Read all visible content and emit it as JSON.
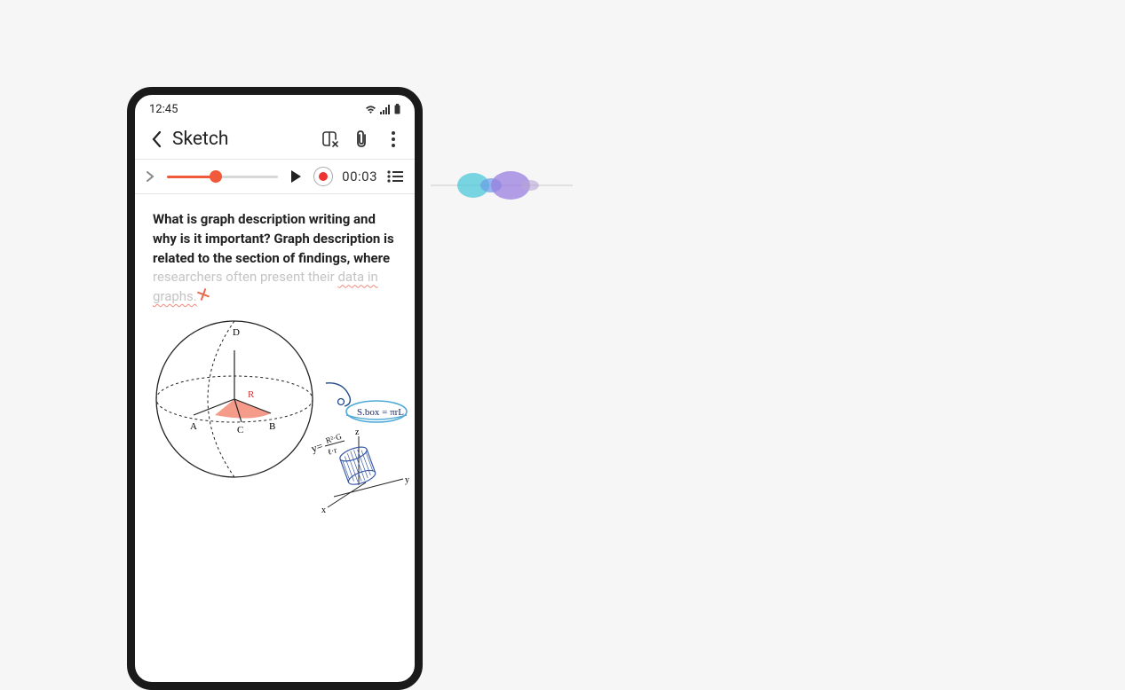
{
  "status": {
    "time": "12:45"
  },
  "header": {
    "title": "Sketch"
  },
  "audio": {
    "time": "00:03",
    "progress_pct": 44
  },
  "content": {
    "bold_part": "What is graph description writing and why is it important? Graph description is related to the section of findings, where ",
    "faded_part": "researchers often present their ",
    "wavy_part": "data in graphs."
  },
  "sketch": {
    "labels": {
      "A": "A",
      "B": "B",
      "C": "C",
      "D": "D",
      "R": "R"
    },
    "formula1_l": "y=",
    "formula1_r_top": "R²·G",
    "formula1_r_bot": "ℓ·r",
    "formula2": "S.box = πrL",
    "axis_x": "x",
    "axis_y": "y",
    "axis_z": "z"
  }
}
